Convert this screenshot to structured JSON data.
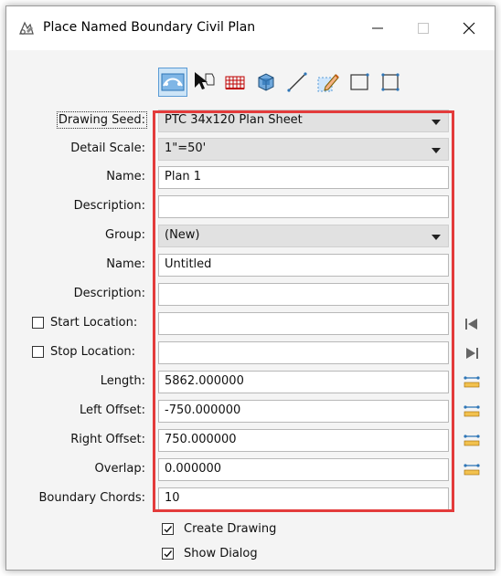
{
  "window": {
    "title": "Place Named Boundary Civil Plan",
    "icon": "civil-plan-icon"
  },
  "toolbar": {
    "tools": [
      {
        "name": "civil-plan-tool-icon",
        "active": true
      },
      {
        "name": "select-element-icon"
      },
      {
        "name": "grid-icon"
      },
      {
        "name": "3d-box-icon"
      },
      {
        "name": "line-icon"
      },
      {
        "name": "pencil-icon"
      },
      {
        "name": "rectangle-icon"
      },
      {
        "name": "shape-icon"
      }
    ]
  },
  "fields": {
    "drawing_seed": {
      "label": "Drawing Seed:",
      "value": "PTC 34x120 Plan Sheet"
    },
    "detail_scale": {
      "label": "Detail Scale:",
      "value": "1\"=50'"
    },
    "name": {
      "label": "Name:",
      "value": "Plan 1"
    },
    "description": {
      "label": "Description:",
      "value": ""
    },
    "group": {
      "label": "Group:",
      "value": "(New)"
    },
    "group_name": {
      "label": "Name:",
      "value": "Untitled"
    },
    "group_description": {
      "label": "Description:",
      "value": ""
    },
    "start_location": {
      "label": "Start Location:",
      "value": "",
      "checked": false
    },
    "stop_location": {
      "label": "Stop Location:",
      "value": "",
      "checked": false
    },
    "length": {
      "label": "Length:",
      "value": "5862.000000"
    },
    "left_offset": {
      "label": "Left Offset:",
      "value": "-750.000000"
    },
    "right_offset": {
      "label": "Right Offset:",
      "value": "750.000000"
    },
    "overlap": {
      "label": "Overlap:",
      "value": "0.000000"
    },
    "boundary_chords": {
      "label": "Boundary Chords:",
      "value": "10"
    }
  },
  "options": {
    "create_drawing": {
      "label": "Create Drawing",
      "checked": true
    },
    "show_dialog": {
      "label": "Show Dialog",
      "checked": true
    }
  },
  "colors": {
    "highlight_frame": "#e33b3b",
    "active_tool": "#cce4f7",
    "measure_icon": "#2e75b6"
  }
}
